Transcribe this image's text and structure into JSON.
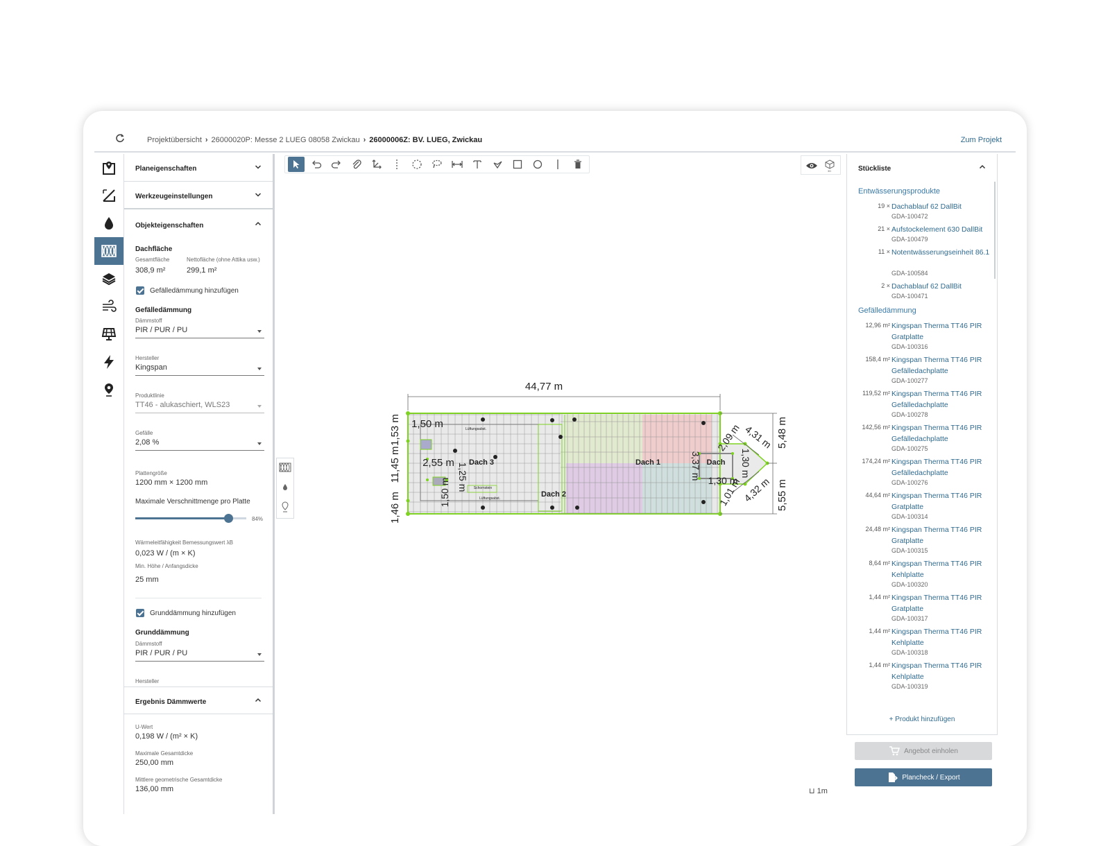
{
  "breadcrumb": {
    "items": [
      "Projektübersicht",
      "26000020P: Messe 2 LUEG 08058 Zwickau"
    ],
    "current": "26000006Z: BV. LUEG, Zwickau"
  },
  "header": {
    "to_project": "Zum Projekt"
  },
  "rail": [
    "plan-pin",
    "measure",
    "drainage",
    "insulation",
    "layers",
    "wind",
    "solar",
    "lightning",
    "location"
  ],
  "left": {
    "sections": {
      "plan": "Planeigenschaften",
      "tools": "Werkzeugeinstellungen",
      "object": "Objekteigenschaften",
      "result": "Ergebnis Dämmwerte"
    },
    "dachflaeche": {
      "title": "Dachfläche",
      "gesamt_label": "Gesamtfläche",
      "gesamt_value": "308,9 m²",
      "netto_label": "Nettofläche (ohne Attika usw.)",
      "netto_value": "299,1 m²"
    },
    "gefaelle_check": "Gefälledämmung hinzufügen",
    "gefaelle": {
      "title": "Gefälledämmung",
      "daemmstoff_label": "Dämmstoff",
      "daemmstoff_value": "PIR / PUR / PU",
      "hersteller_label": "Hersteller",
      "hersteller_value": "Kingspan",
      "produktlinie_label": "Produktlinie",
      "produktlinie_value": "TT46 - alukaschiert, WLS23",
      "gefaelle_label": "Gefälle",
      "gefaelle_value": "2,08 %",
      "platten_label": "Plattengröße",
      "platten_value": "1200 mm × 1200 mm",
      "verschnitt_label": "Maximale Verschnittmenge pro Platte",
      "verschnitt_percent": 84,
      "verschnitt_text": "84%",
      "lambda_label": "Wärmeleitfähigkeit Bemessungswert λB",
      "lambda_value": "0,023 W / (m × K)",
      "minhoehe_label": "Min. Höhe / Anfangsdicke",
      "minhoehe_value": "25 mm"
    },
    "grund_check": "Grunddämmung hinzufügen",
    "grund": {
      "title": "Grunddämmung",
      "daemmstoff_label": "Dämmstoff",
      "daemmstoff_value": "PIR / PUR / PU",
      "hersteller_label": "Hersteller"
    },
    "result": {
      "u_label": "U-Wert",
      "u_value": "0,198 W / (m² × K)",
      "max_label": "Maximale Gesamtdicke",
      "max_value": "250,00 mm",
      "mid_label": "Mittlere geometrische Gesamtdicke",
      "mid_value": "136,00 mm"
    }
  },
  "toolbar": [
    "select",
    "undo",
    "redo",
    "attach",
    "axis",
    "dashed-line",
    "circle-dashed",
    "lasso",
    "dimension",
    "text",
    "fill",
    "rectangle",
    "ellipse",
    "line",
    "delete"
  ],
  "view": [
    "eye",
    "3d"
  ],
  "plan": {
    "dims": {
      "top": "44,77 m",
      "left_top": "1,53 m",
      "left_mid": "11,45 m",
      "left_bot": "1,46 m",
      "right_top": "5,48 m",
      "right_bot": "5,55 m",
      "d150": "1,50 m",
      "d255": "2,55 m",
      "d125": "1,25 m",
      "d150b": "1,50 m",
      "d209": "2,09 m",
      "d431": "4,31 m",
      "d337": "3,37 m",
      "d130": "1,30 m",
      "d130b": "1,30 m",
      "d101": "1,01 m",
      "d432": "4,32 m"
    },
    "roofs": {
      "dach1": "Dach 1",
      "dach2": "Dach 2",
      "dach3": "Dach 3",
      "dach": "Dach"
    },
    "small": {
      "lueftung1": "Lüftungsabst.",
      "schornstein": "Schornstein",
      "lueftung2": "Lüftungsabst."
    },
    "scale": "1m"
  },
  "right": {
    "title": "Stückliste",
    "groups": [
      {
        "title": "Entwässerungsprodukte",
        "items": [
          {
            "qty": "19 ×",
            "name": "Dachablauf 62 DallBit",
            "code": "GDA-100472"
          },
          {
            "qty": "21 ×",
            "name": "Aufstockelement 630 DallBit",
            "code": "GDA-100479"
          },
          {
            "qty": "11 ×",
            "name": "Notentwässerungseinheit 86.1",
            "code": "GDA-100584"
          },
          {
            "qty": "2 ×",
            "name": "Dachablauf 62 DallBit",
            "code": "GDA-100471"
          }
        ]
      },
      {
        "title": "Gefälledämmung",
        "items": [
          {
            "qty": "12,96 m²",
            "name": "Kingspan Therma TT46 PIR Gratplatte",
            "code": "GDA-100316"
          },
          {
            "qty": "158,4 m²",
            "name": "Kingspan Therma TT46 PIR Gefälledachplatte",
            "code": "GDA-100277"
          },
          {
            "qty": "119,52 m²",
            "name": "Kingspan Therma TT46 PIR Gefälledachplatte",
            "code": "GDA-100278"
          },
          {
            "qty": "142,56 m²",
            "name": "Kingspan Therma TT46 PIR Gefälledachplatte",
            "code": "GDA-100275"
          },
          {
            "qty": "174,24 m²",
            "name": "Kingspan Therma TT46 PIR Gefälledachplatte",
            "code": "GDA-100276"
          },
          {
            "qty": "44,64 m²",
            "name": "Kingspan Therma TT46 PIR Gratplatte",
            "code": "GDA-100314"
          },
          {
            "qty": "24,48 m²",
            "name": "Kingspan Therma TT46 PIR Gratplatte",
            "code": "GDA-100315"
          },
          {
            "qty": "8,64 m²",
            "name": "Kingspan Therma TT46 PIR Kehlplatte",
            "code": "GDA-100320"
          },
          {
            "qty": "1,44 m²",
            "name": "Kingspan Therma TT46 PIR Gratplatte",
            "code": "GDA-100317"
          },
          {
            "qty": "1,44 m²",
            "name": "Kingspan Therma TT46 PIR Kehlplatte",
            "code": "GDA-100318"
          },
          {
            "qty": "1,44 m²",
            "name": "Kingspan Therma TT46 PIR Kehlplatte",
            "code": "GDA-100319"
          }
        ]
      }
    ],
    "add_product": "Produkt hinzufügen"
  },
  "buttons": {
    "offer": "Angebot einholen",
    "export": "Plancheck / Export"
  },
  "colors": {
    "accent": "#4d7392",
    "link": "#2f6a8f",
    "plan_green": "#7ed321"
  }
}
